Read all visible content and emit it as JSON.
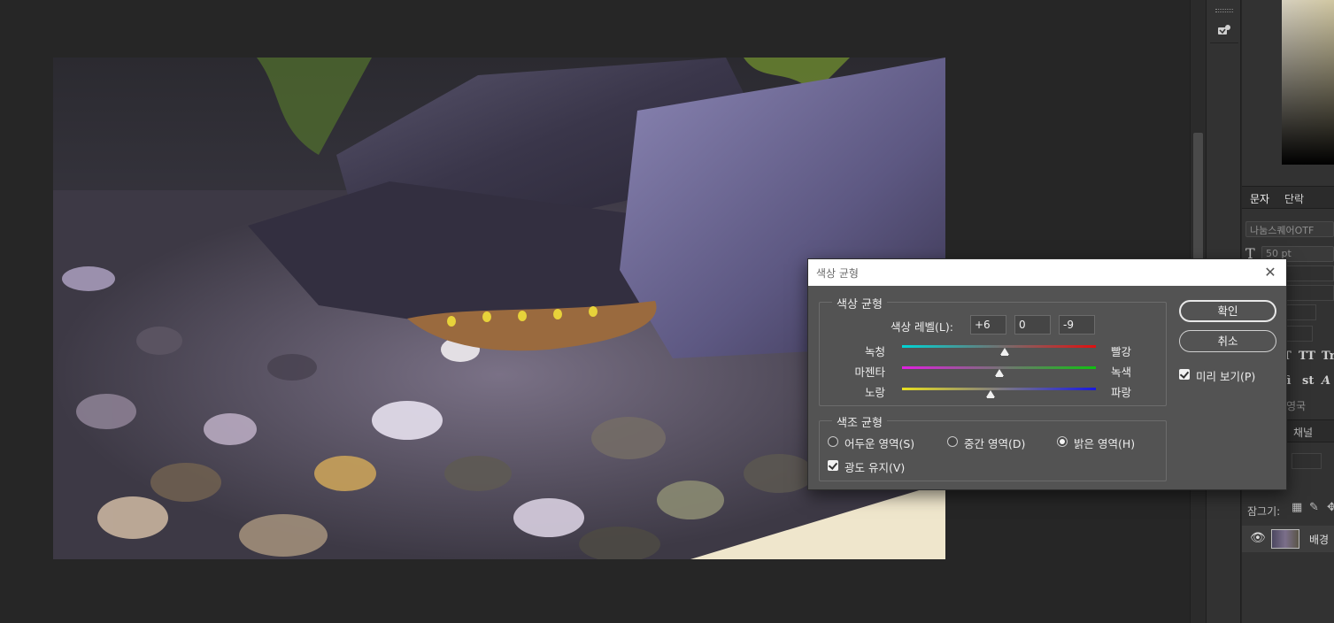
{
  "dialog": {
    "title": "색상 균형",
    "close_icon": "close-icon",
    "color_balance_group": {
      "legend": "색상 균형",
      "levels_label": "색상 레벨(L):",
      "levels": [
        "+6",
        "0",
        "-9"
      ],
      "sliders": [
        {
          "left": "녹청",
          "right": "빨강",
          "track_from": "#00d4d4",
          "track_to": "#e01010",
          "value": 6
        },
        {
          "left": "마젠타",
          "right": "녹색",
          "track_from": "#e020e0",
          "track_to": "#10c010",
          "value": 0
        },
        {
          "left": "노랑",
          "right": "파랑",
          "track_from": "#e8e020",
          "track_to": "#1818e0",
          "value": -9
        }
      ]
    },
    "tone_balance_group": {
      "legend": "색조 균형",
      "options": [
        {
          "label": "어두운 영역(S)",
          "selected": false
        },
        {
          "label": "중간 영역(D)",
          "selected": false
        },
        {
          "label": "밝은 영역(H)",
          "selected": true
        }
      ],
      "preserve_luminosity": "광도 유지(V)"
    },
    "ok_label": "확인",
    "cancel_label": "취소",
    "preview_label": "미리 보기(P)"
  },
  "panel": {
    "tabs_top": [
      "문자",
      "단락"
    ],
    "font_name": "나눔스퀘어OTF",
    "font_size": "50 pt",
    "language": "영국",
    "tabs_bottom": [
      "채널"
    ],
    "lock_label": "잠그기:",
    "layer_name": "배경"
  }
}
